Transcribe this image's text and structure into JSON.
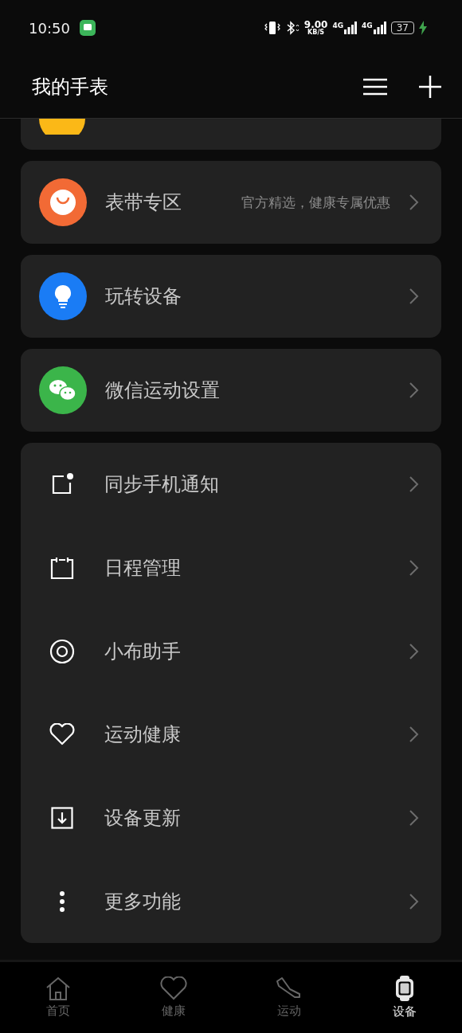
{
  "status_bar": {
    "time": "10:50",
    "speed": "9.00",
    "speed_unit": "KB/S",
    "network_1": "4G",
    "network_2": "4G",
    "battery": "37"
  },
  "header": {
    "title": "我的手表"
  },
  "cards": [
    {
      "kind": "bag",
      "title": "表带专区",
      "subtitle": "官方精选，健康专属优惠"
    },
    {
      "kind": "bulb",
      "title": "玩转设备"
    },
    {
      "kind": "wechat",
      "title": "微信运动设置"
    }
  ],
  "settings": [
    {
      "kind": "notification",
      "label": "同步手机通知"
    },
    {
      "kind": "calendar",
      "label": "日程管理"
    },
    {
      "kind": "assistant",
      "label": "小布助手"
    },
    {
      "kind": "heart",
      "label": "运动健康"
    },
    {
      "kind": "update",
      "label": "设备更新"
    },
    {
      "kind": "more",
      "label": "更多功能"
    }
  ],
  "tabs": [
    {
      "kind": "home",
      "label": "首页",
      "selected": false
    },
    {
      "kind": "heart",
      "label": "健康",
      "selected": false
    },
    {
      "kind": "shoe",
      "label": "运动",
      "selected": false
    },
    {
      "kind": "watch",
      "label": "设备",
      "selected": true
    }
  ]
}
